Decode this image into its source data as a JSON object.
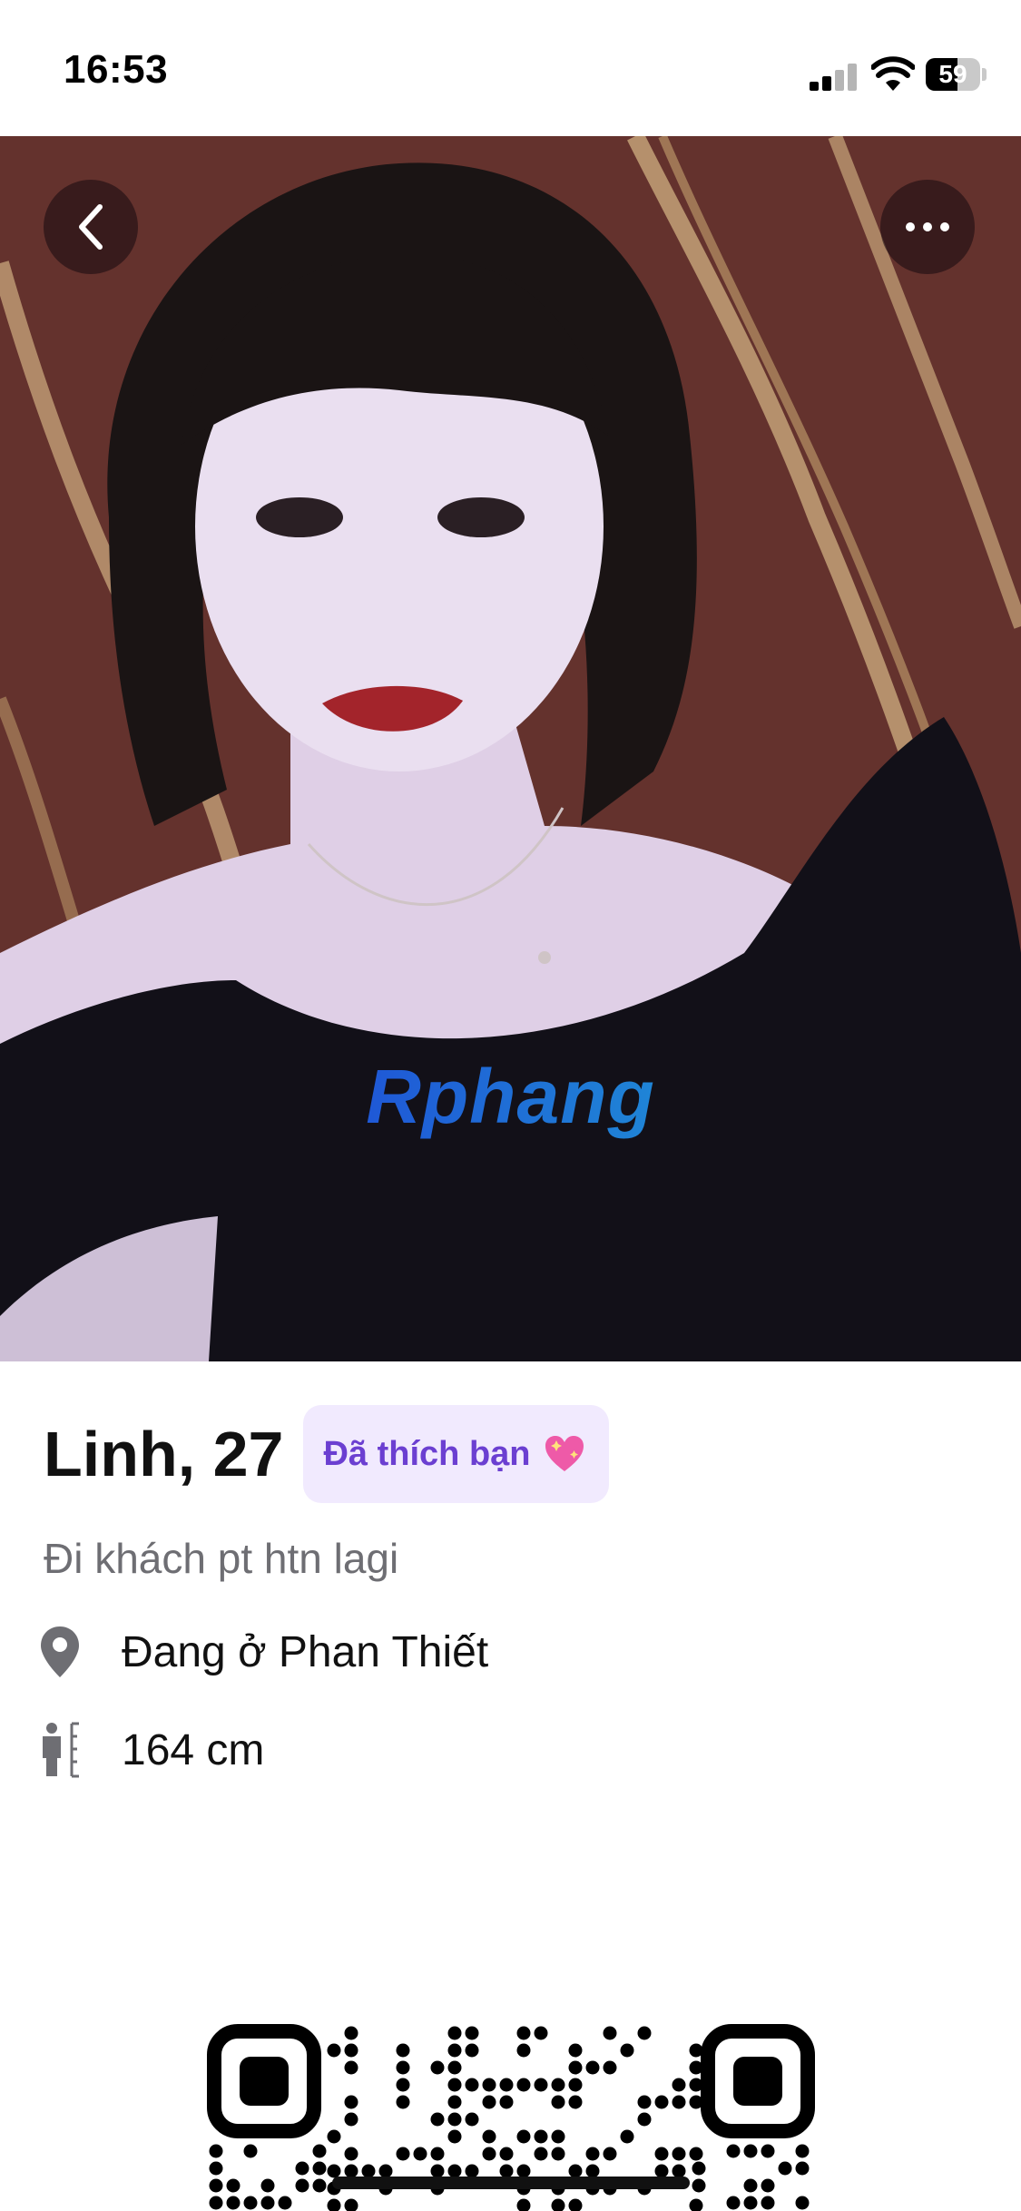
{
  "status_bar": {
    "time": "16:53",
    "battery": "59",
    "battery_level": 0.59
  },
  "photo": {
    "back_icon": "chevron-left-icon",
    "more_icon": "ellipsis-icon",
    "watermark": "Rphang"
  },
  "profile": {
    "name_age": "Linh, 27",
    "liked_badge": "Đã thích bạn",
    "liked_icon": "sparkling-heart-icon",
    "bio": "Đi khách pt htn lagi",
    "location": "Đang ở Phan Thiết",
    "location_icon": "location-pin-icon",
    "height": "164 cm",
    "height_icon": "height-ruler-icon"
  },
  "colors": {
    "badge_bg": "#f1eafe",
    "badge_text": "#6b3fd1",
    "bio_text": "#6e6e73"
  }
}
